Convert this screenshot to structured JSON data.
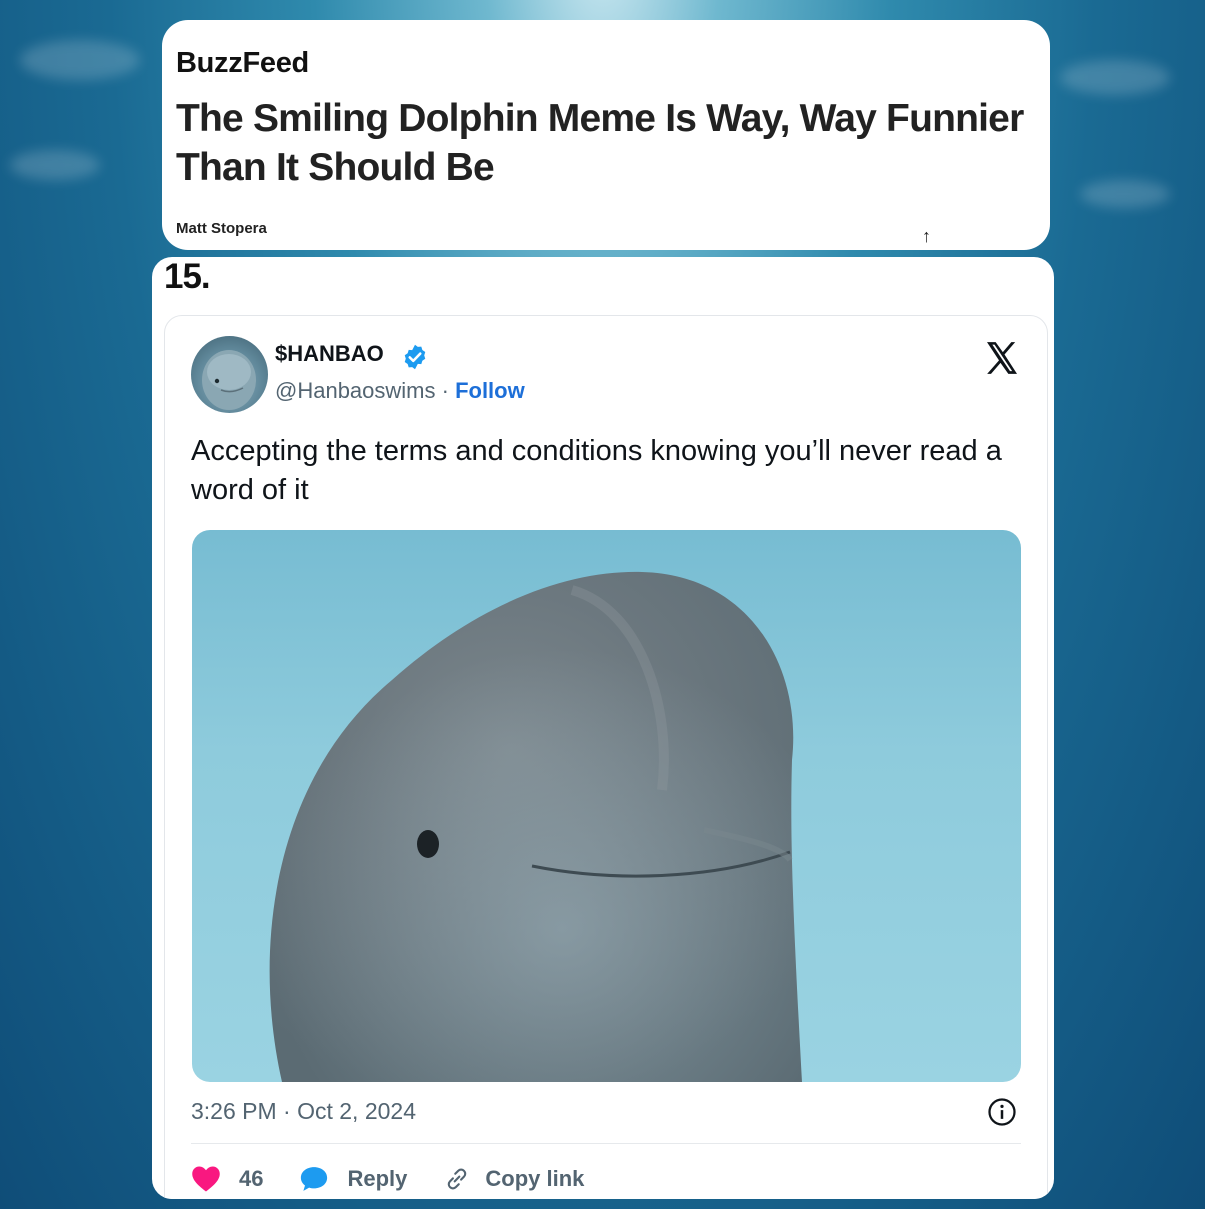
{
  "article": {
    "publisher": "BuzzFeed",
    "headline": "The Smiling Dolphin Meme Is Way, Way Funnier Than It Should Be",
    "author": "Matt Stopera"
  },
  "item_number": "15.",
  "tweet": {
    "display_name": "$HANBAO",
    "handle": "@Hanbaoswims",
    "separator": " · ",
    "follow_label": "Follow",
    "text": "Accepting the terms and conditions knowing you’ll never read a word of it",
    "timestamp": "3:26 PM · Oct 2, 2024",
    "likes": "46",
    "reply_label": "Reply",
    "copy_link_label": "Copy link"
  },
  "icons": {
    "verified": "verified-badge-icon",
    "platform": "x-logo-icon",
    "info": "info-icon",
    "like": "heart-icon",
    "reply": "speech-bubble-icon",
    "copy": "link-icon"
  },
  "colors": {
    "follow": "#1d6fd8",
    "verified": "#1d9bf0",
    "heart": "#f91880",
    "reply_bubble": "#1d9bf0",
    "muted_text": "#536471"
  }
}
